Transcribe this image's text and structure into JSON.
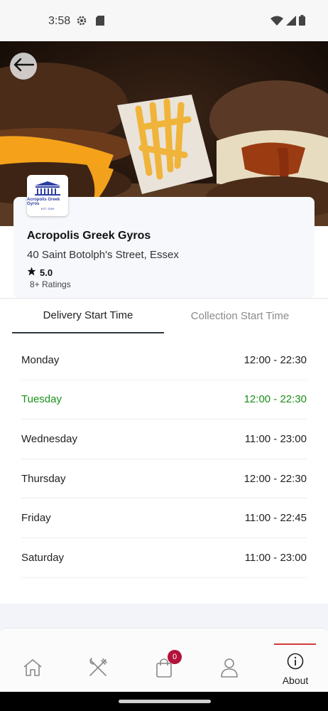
{
  "status_bar": {
    "time": "3:58"
  },
  "restaurant": {
    "logo_text": "Acropolis Greek Gyros",
    "logo_subtext": "EST. 2009",
    "name": "Acropolis Greek Gyros",
    "address": "40 Saint Botolph's Street, Essex",
    "rating": "5.0",
    "ratings_count": "8+ Ratings"
  },
  "tabs": [
    {
      "label": "Delivery Start Time",
      "selected": true
    },
    {
      "label": "Collection Start Time",
      "selected": false
    }
  ],
  "hours": [
    {
      "day": "Monday",
      "time": "12:00 - 22:30",
      "active": false
    },
    {
      "day": "Tuesday",
      "time": "12:00 - 22:30",
      "active": true
    },
    {
      "day": "Wednesday",
      "time": "11:00 - 23:00",
      "active": false
    },
    {
      "day": "Thursday",
      "time": "12:00 - 22:30",
      "active": false
    },
    {
      "day": "Friday",
      "time": "11:00 - 22:45",
      "active": false
    },
    {
      "day": "Saturday",
      "time": "11:00 - 23:00",
      "active": false
    }
  ],
  "bottom_nav": {
    "items": [
      {
        "icon": "home-icon"
      },
      {
        "icon": "fork-knife-icon"
      },
      {
        "icon": "shopping-bag-icon",
        "badge": "0"
      },
      {
        "icon": "user-icon"
      },
      {
        "icon": "info-icon",
        "label": "About",
        "selected": true
      }
    ]
  },
  "colors": {
    "accent_active": "#1a8f1a",
    "badge": "#b3123a",
    "selected_indicator": "#d33a3a"
  }
}
